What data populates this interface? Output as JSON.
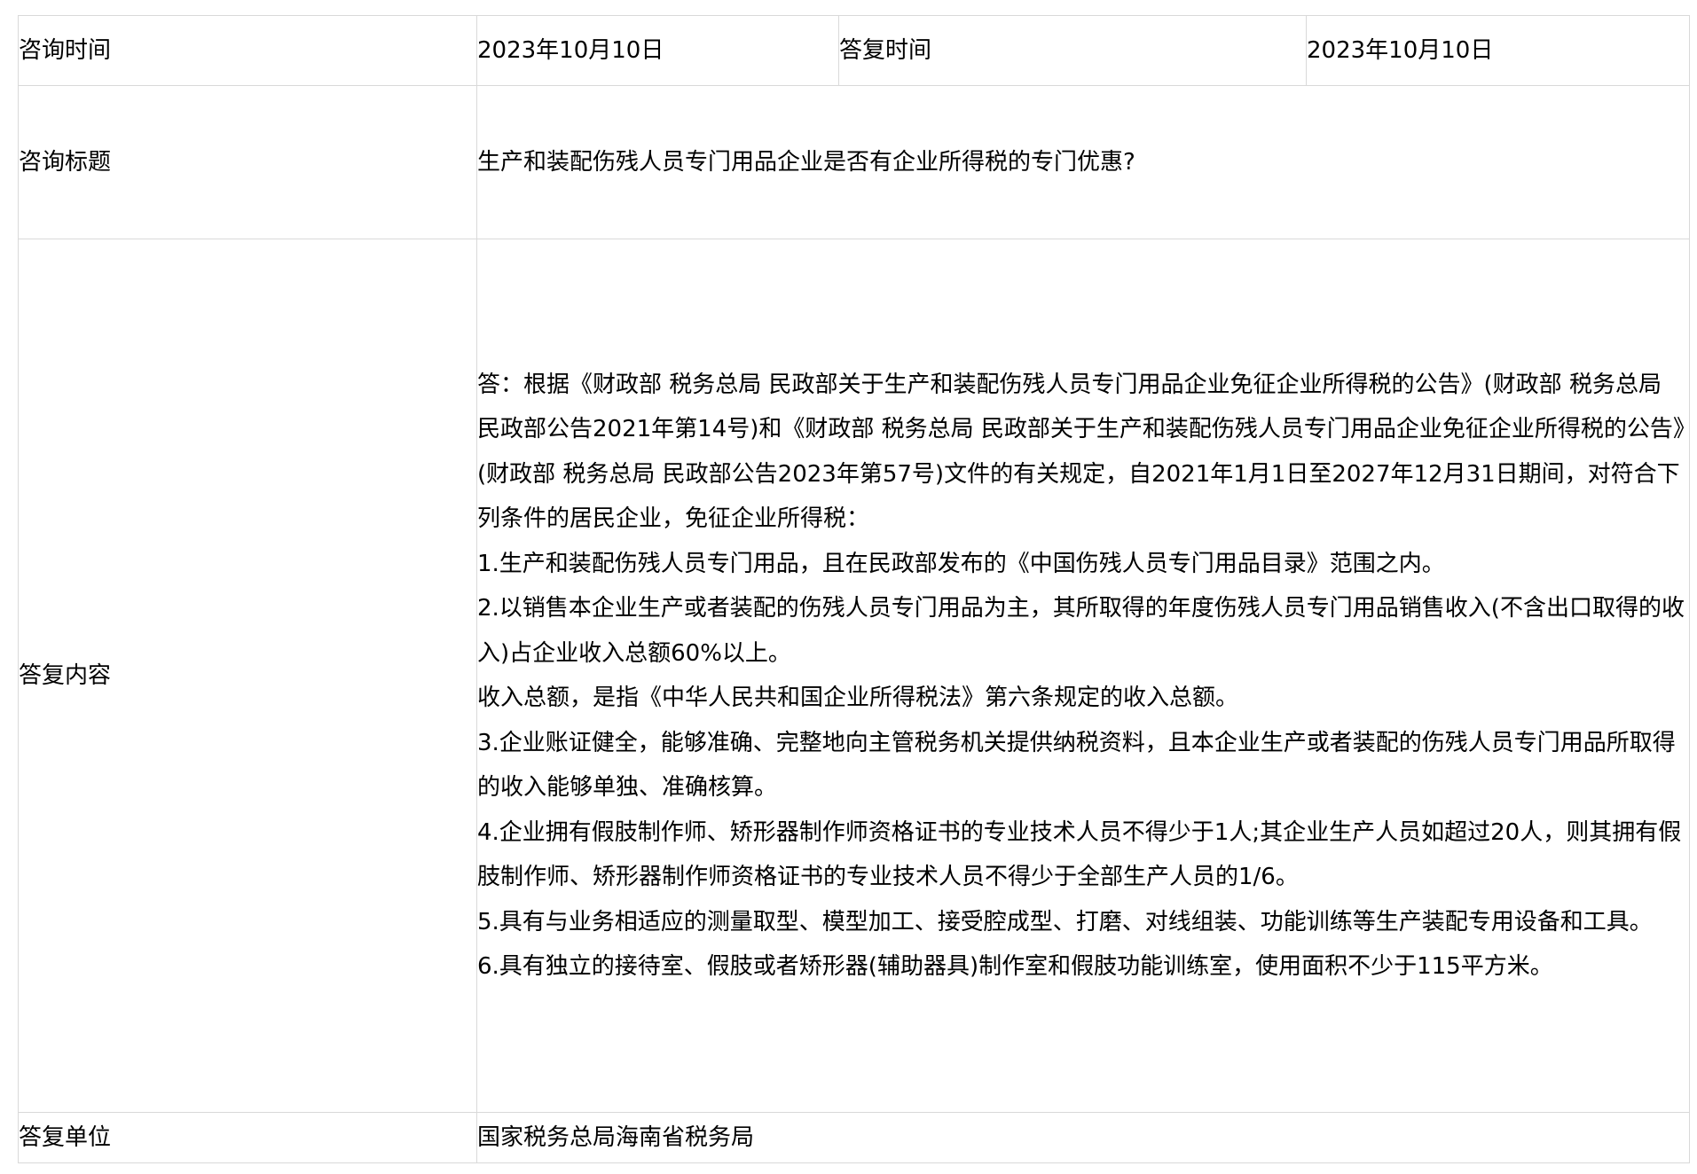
{
  "consult_time": {
    "label": "咨询时间",
    "value": "2023年10月10日"
  },
  "reply_time": {
    "label": "答复时间",
    "value": "2023年10月10日"
  },
  "consult_title": {
    "label": "咨询标题",
    "value": "生产和装配伤残人员专门用品企业是否有企业所得税的专门优惠?"
  },
  "reply_content": {
    "label": "答复内容",
    "paragraphs": [
      "答：根据《财政部 税务总局 民政部关于生产和装配伤残人员专门用品企业免征企业所得税的公告》(财政部 税务总局 民政部公告2021年第14号)和《财政部 税务总局 民政部关于生产和装配伤残人员专门用品企业免征企业所得税的公告》(财政部 税务总局 民政部公告2023年第57号)文件的有关规定，自2021年1月1日至2027年12月31日期间，对符合下列条件的居民企业，免征企业所得税：",
      "1.生产和装配伤残人员专门用品，且在民政部发布的《中国伤残人员专门用品目录》范围之内。",
      "2.以销售本企业生产或者装配的伤残人员专门用品为主，其所取得的年度伤残人员专门用品销售收入(不含出口取得的收入)占企业收入总额60%以上。",
      "收入总额，是指《中华人民共和国企业所得税法》第六条规定的收入总额。",
      "3.企业账证健全，能够准确、完整地向主管税务机关提供纳税资料，且本企业生产或者装配的伤残人员专门用品所取得的收入能够单独、准确核算。",
      "4.企业拥有假肢制作师、矫形器制作师资格证书的专业技术人员不得少于1人;其企业生产人员如超过20人，则其拥有假肢制作师、矫形器制作师资格证书的专业技术人员不得少于全部生产人员的1/6。",
      "5.具有与业务相适应的测量取型、模型加工、接受腔成型、打磨、对线组装、功能训练等生产装配专用设备和工具。",
      "6.具有独立的接待室、假肢或者矫形器(辅助器具)制作室和假肢功能训练室，使用面积不少于115平方米。"
    ]
  },
  "reply_unit": {
    "label": "答复单位",
    "value": "国家税务总局海南省税务局"
  },
  "colors": {
    "border": "#d9d9d9",
    "text": "#000000",
    "background": "#ffffff"
  }
}
